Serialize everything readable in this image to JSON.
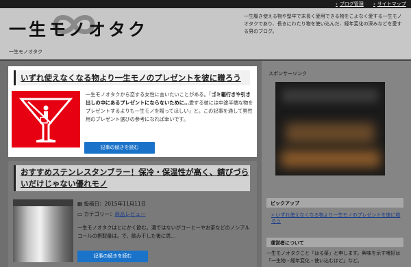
{
  "topbar": {
    "links": [
      {
        "label": "ブログ管理"
      },
      {
        "label": "サイトマップ"
      }
    ]
  },
  "header": {
    "logo_text": "一生モノオタク",
    "site_name": "一生モノオタク",
    "description": "一生履き使える物や堅牢で末長く愛用できる物をこよなく愛する一生モノオタクであり、長きにわたり物を使い込んだ、経年変化の深みなどを愛する男のブログ。"
  },
  "posts": [
    {
      "title": "いずれ使えなくなる物より一生モノのプレゼントを彼に贈ろう",
      "excerpt_intro": "一生モノオタクから恋する女性に言いたいことがある。「",
      "excerpt_bold": "ゴミ箱行きや引き出しの中にあるプレゼントにならないために…",
      "excerpt_rest": "愛する彼には中途半端な物をプレゼントするよりも一生モノを贈ってほしい」と。この記事を通して男性用のプレゼント選びの参考になれば幸いです。",
      "read_more": "記事の続きを読む"
    },
    {
      "title": "おすすめステンレスタンブラー！保冷・保温性が高く、錆びづらいだけじゃない優れモノ",
      "date_label": "投稿日：2015年11月11日",
      "category_prefix": "カテゴリー：",
      "category": "商品レビュー",
      "excerpt": "一生モノオタクはとにかく飲む。酒ではないがコーヒーやお茶などのノンアルコールの摂取量は。で、飲み干した後に思…",
      "read_more": "記事の続きを読む"
    }
  ],
  "sidebar": {
    "sponsor_label": "スポンサーリンク",
    "pickup_heading": "ピックアップ",
    "pickup_link": "いずれ使えなくなる物より一生モノのプレゼントを彼に贈ろう",
    "admin_heading": "運営者について",
    "admin_text": "一生モノオタクこと「はる菜」と申します。興味を示す嗜好は「一生物・経年変化・使い込むほど」など。"
  },
  "colors": {
    "button_blue": "#1a73c9",
    "thumb_red": "#e60012",
    "link_blue": "#1a3d8a"
  },
  "icons": {
    "toplink": "arrow-right-icon",
    "date": "calendar-icon",
    "category": "folder-icon",
    "logo": "infinity-icon",
    "thumb": "no-trash-sign-icon"
  }
}
